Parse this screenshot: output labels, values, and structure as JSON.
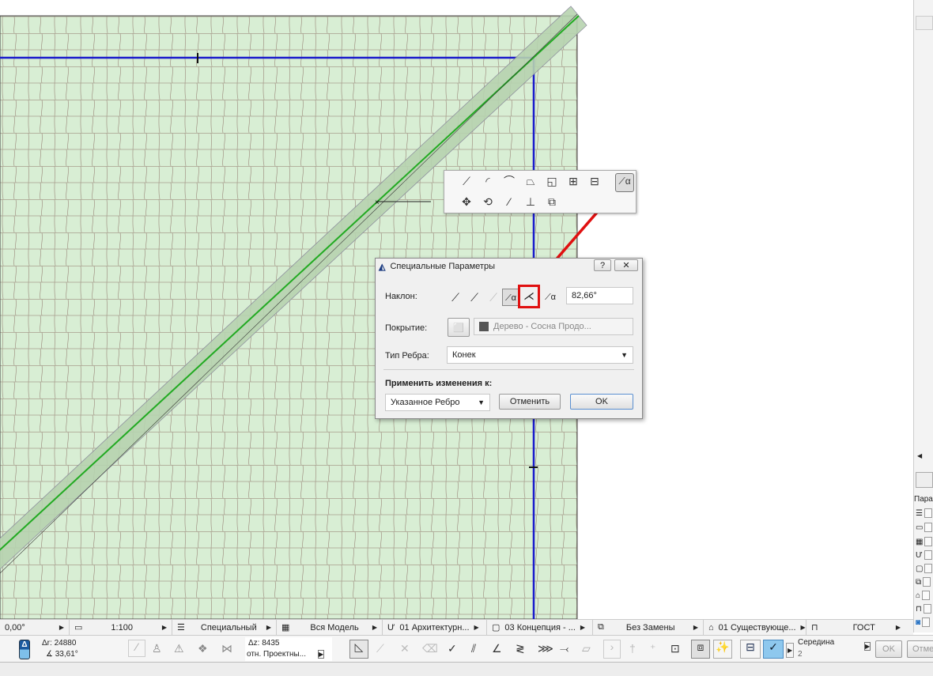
{
  "toolbox": {
    "icons": [
      "add-point-icon",
      "curve-edge-icon",
      "arc-edge-icon",
      "offset-edge-icon",
      "offset-all-icon",
      "add-polygon-icon",
      "subtract-polygon-icon",
      "move-icon",
      "rotate-icon",
      "mirror-icon",
      "elevate-icon",
      "copy-icon",
      "custom-settings-icon"
    ]
  },
  "dialog": {
    "title": "Специальные Параметры",
    "help": "?",
    "close": "✕",
    "slope_label": "Наклон:",
    "slope_value": "82,66°",
    "cover_label": "Покрытие:",
    "cover_value": "Дерево - Сосна Продо...",
    "edge_label": "Тип Ребра:",
    "edge_value": "Конек",
    "apply_label": "Применить изменения к:",
    "apply_value": "Указанное Ребро",
    "cancel": "Отменить",
    "ok": "OK"
  },
  "statusbar": {
    "angle": "0,00°",
    "scale": "1:100",
    "layers": "Специальный",
    "model": "Вся Модель",
    "pen": "01 Архитектурн...",
    "view": "03 Концепция - ...",
    "override": "Без Замены",
    "renovation": "01 Существующе...",
    "dimension": "ГОСТ"
  },
  "coords": {
    "dr": "Δr: 24880",
    "a": "∡ 33,61°",
    "dz": "Δz: 8435",
    "ref": "отн. Проектны...",
    "snap": "Середина",
    "snap_num": "2",
    "ok": "OK",
    "cancel": "Отме"
  },
  "right_panel": {
    "label": "Пара"
  },
  "colors": {
    "fill": "#d6ecd2",
    "tile": "#a09a8c",
    "blue": "#1a1acc",
    "green": "#22aa22",
    "red": "#e01010"
  }
}
